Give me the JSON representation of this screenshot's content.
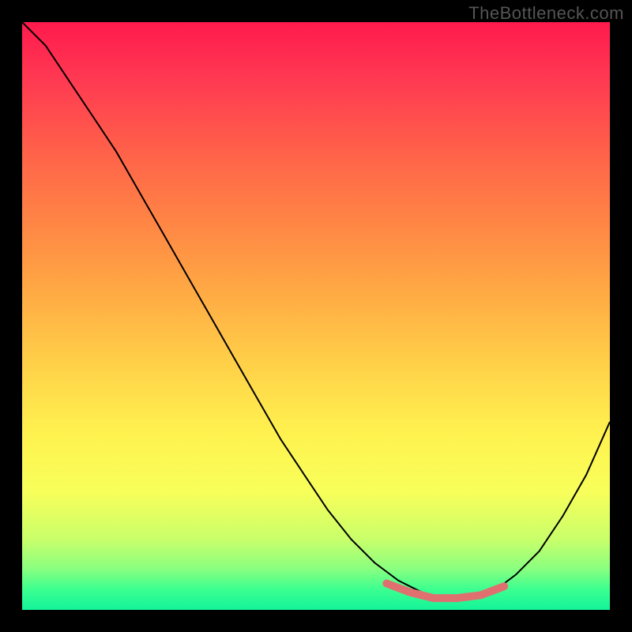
{
  "watermark": "TheBottleneck.com",
  "chart_data": {
    "type": "line",
    "title": "",
    "xlabel": "",
    "ylabel": "",
    "xlim": [
      0,
      100
    ],
    "ylim": [
      0,
      100
    ],
    "series": [
      {
        "name": "bottleneck-curve",
        "x": [
          0,
          4,
          8,
          12,
          16,
          20,
          24,
          28,
          32,
          36,
          40,
          44,
          48,
          52,
          56,
          60,
          64,
          68,
          72,
          76,
          80,
          84,
          88,
          92,
          96,
          100
        ],
        "y": [
          100,
          96,
          90,
          84,
          78,
          71,
          64,
          57,
          50,
          43,
          36,
          29,
          23,
          17,
          12,
          8,
          5,
          3,
          2,
          2,
          3,
          6,
          10,
          16,
          23,
          32
        ]
      }
    ],
    "highlight": {
      "name": "optimal-range",
      "x": [
        62,
        66,
        70,
        74,
        78,
        82
      ],
      "y": [
        4.5,
        3,
        2,
        2,
        2.5,
        4
      ]
    },
    "gradient_stops": [
      {
        "pos": 0,
        "color": "#ff1a4d"
      },
      {
        "pos": 50,
        "color": "#ffc447"
      },
      {
        "pos": 80,
        "color": "#fbff55"
      },
      {
        "pos": 100,
        "color": "#14f39a"
      }
    ]
  }
}
